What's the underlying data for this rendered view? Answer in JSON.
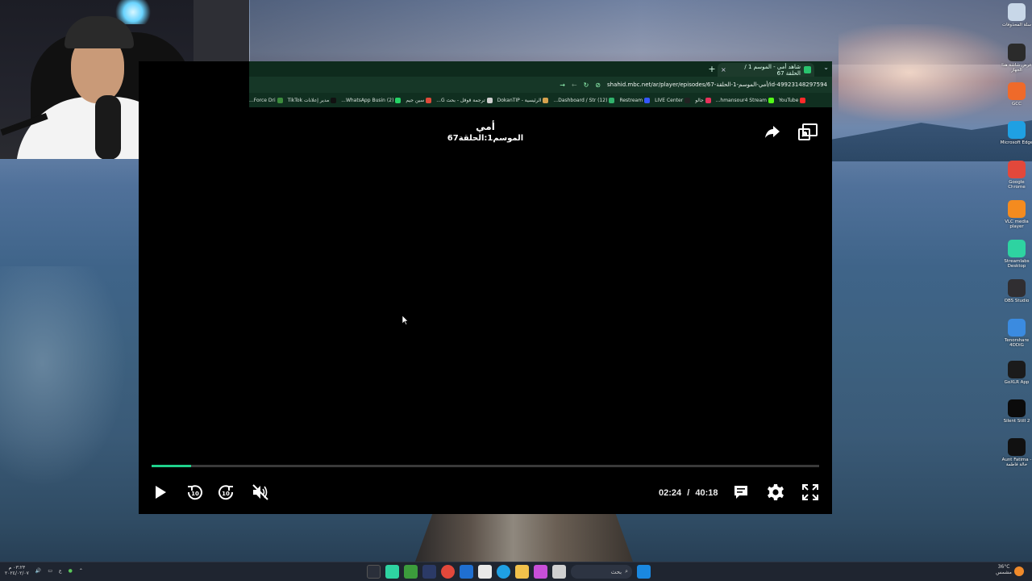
{
  "browser": {
    "tab_title": "شاهد أمي - الموسم 1 / الحلقة 67",
    "new_tab": "+",
    "tab_close": "×",
    "url": "shahid.mbc.net/ar/player/episodes/67-أمي-الموسم-1-الحلقة/id-49923148297594",
    "bookmarks": [
      {
        "label": "YouTube",
        "color": "#ff2a2a"
      },
      {
        "label": "hmansour4 Stream...",
        "color": "#53fc18"
      },
      {
        "label": "جالو",
        "color": "#e8315b"
      },
      {
        "label": "LIVE Center",
        "color": "#222"
      },
      {
        "label": "Restream",
        "color": "#3557ff"
      },
      {
        "label": "(12) Dashboard / Str...",
        "color": "#31b26c"
      },
      {
        "label": "الرئيسية - DokanTIP",
        "color": "#d6a24e"
      },
      {
        "label": "ترجمة قوقل - بحث G...",
        "color": "#cfcfcf"
      },
      {
        "label": "سين جيم",
        "color": "#e04a3a"
      },
      {
        "label": "(2) WhatsApp Busin...",
        "color": "#25d366"
      },
      {
        "label": "مدير إعلانات TikTok",
        "color": "#111"
      },
      {
        "label": "Force Dri...",
        "color": "#3c8c3c"
      }
    ]
  },
  "player": {
    "title": "أمي",
    "subtitle": "الموسم1:الحلقة67",
    "current_time": "02:24",
    "time_separator": "/",
    "total_time": "40:18",
    "progress": 0.0596,
    "accent_color": "#1fd18b"
  },
  "desktop_icons": [
    {
      "label": "سلة المحذوفات",
      "icon": "recycle-bin-icon",
      "color": "#c8d7e8"
    },
    {
      "label": "عرض شاشة هذا الجهاز",
      "icon": "screen-mirror-icon",
      "color": "#2b2b2b"
    },
    {
      "label": "GCC",
      "icon": "gcc-icon",
      "color": "#ef6a2a"
    },
    {
      "label": "Microsoft Edge",
      "icon": "edge-icon",
      "color": "#1fa0e3"
    },
    {
      "label": "Google Chrome",
      "icon": "chrome-icon",
      "color": "#e2483b"
    },
    {
      "label": "VLC media player",
      "icon": "vlc-icon",
      "color": "#f48b1f"
    },
    {
      "label": "Streamlabs Desktop",
      "icon": "streamlabs-icon",
      "color": "#2ed3a1"
    },
    {
      "label": "OBS Studio",
      "icon": "obs-icon",
      "color": "#302e31"
    },
    {
      "label": "Tenorshare 4DDiG",
      "icon": "tenorshare-icon",
      "color": "#3b8be0"
    },
    {
      "label": "GoXLR App",
      "icon": "goxlr-icon",
      "color": "#1b1b1b"
    },
    {
      "label": "Silent Still 2",
      "icon": "silent-still-icon",
      "color": "#0b0b0b"
    },
    {
      "label": "Aunt Fatima - خالة فاطمة",
      "icon": "aunt-fatima-icon",
      "color": "#111"
    }
  ],
  "taskbar": {
    "clock_time": "٠٣:٢٣ م",
    "clock_date": "٢٠٢٤/٠٢/٠٧",
    "lang": "ع",
    "search_label": "بحث",
    "weather_temp": "36°C",
    "weather_text": "مشمس"
  }
}
